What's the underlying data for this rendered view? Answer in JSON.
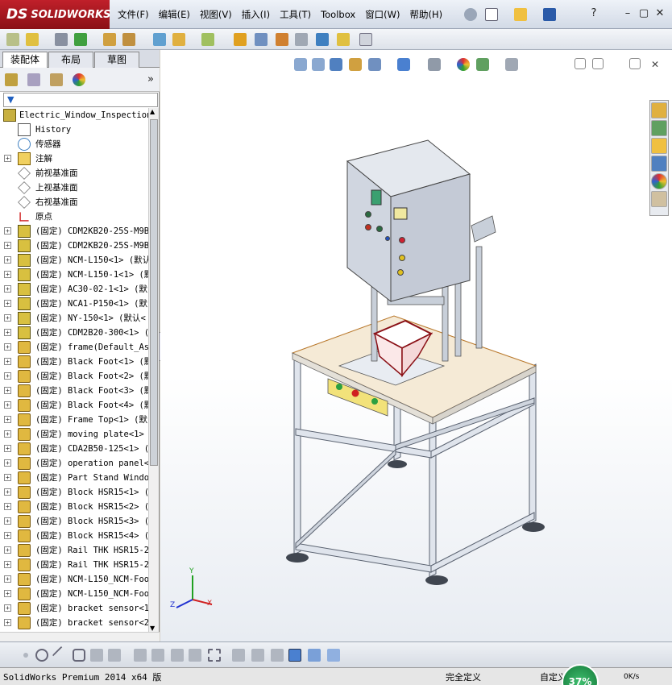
{
  "app": {
    "logo": "SOLIDWORKS",
    "ds": "DS"
  },
  "menu": [
    "文件(F)",
    "编辑(E)",
    "视图(V)",
    "插入(I)",
    "工具(T)",
    "Toolbox",
    "窗口(W)",
    "帮助(H)"
  ],
  "tabs": [
    "装配体",
    "布局",
    "草图"
  ],
  "tree": [
    {
      "label": "Electric_Window_Inspection",
      "icon": "assembly",
      "exp": false,
      "indent": 0
    },
    {
      "label": "History",
      "icon": "history",
      "exp": false,
      "indent": 1
    },
    {
      "label": "传感器",
      "icon": "sensor",
      "exp": false,
      "indent": 1
    },
    {
      "label": "注解",
      "icon": "annotation",
      "exp": true,
      "indent": 1
    },
    {
      "label": "前视基准面",
      "icon": "plane",
      "exp": false,
      "indent": 1
    },
    {
      "label": "上视基准面",
      "icon": "plane",
      "exp": false,
      "indent": 1
    },
    {
      "label": "右视基准面",
      "icon": "plane",
      "exp": false,
      "indent": 1
    },
    {
      "label": "原点",
      "icon": "origin",
      "exp": false,
      "indent": 1
    },
    {
      "label": "(固定) CDM2KB20-25S-M9B",
      "icon": "subasm",
      "exp": true,
      "indent": 1
    },
    {
      "label": "(固定) CDM2KB20-25S-M9B",
      "icon": "subasm",
      "exp": true,
      "indent": 1
    },
    {
      "label": "(固定) NCM-L150<1> (默认",
      "icon": "subasm",
      "exp": true,
      "indent": 1
    },
    {
      "label": "(固定) NCM-L150-1<1> (默",
      "icon": "subasm",
      "exp": true,
      "indent": 1
    },
    {
      "label": "(固定) AC30-02-1<1> (默",
      "icon": "subasm",
      "exp": true,
      "indent": 1
    },
    {
      "label": "(固定) NCA1-P150<1> (默",
      "icon": "subasm",
      "exp": true,
      "indent": 1
    },
    {
      "label": "(固定) NY-150<1> (默认<",
      "icon": "subasm",
      "exp": true,
      "indent": 1
    },
    {
      "label": "(固定) CDM2B20-300<1> (",
      "icon": "subasm",
      "exp": true,
      "indent": 1
    },
    {
      "label": "(固定) frame(Default_As",
      "icon": "part",
      "exp": true,
      "indent": 1
    },
    {
      "label": "(固定) Black Foot<1> (默",
      "icon": "part",
      "exp": true,
      "indent": 1
    },
    {
      "label": "(固定) Black Foot<2> (默",
      "icon": "part",
      "exp": true,
      "indent": 1
    },
    {
      "label": "(固定) Black Foot<3> (默",
      "icon": "part",
      "exp": true,
      "indent": 1
    },
    {
      "label": "(固定) Black Foot<4> (默",
      "icon": "part",
      "exp": true,
      "indent": 1
    },
    {
      "label": "(固定) Frame Top<1> (默",
      "icon": "part",
      "exp": true,
      "indent": 1
    },
    {
      "label": "(固定) moving plate<1>",
      "icon": "part",
      "exp": true,
      "indent": 1
    },
    {
      "label": "(固定) CDA2B50-125<1> (",
      "icon": "part",
      "exp": true,
      "indent": 1
    },
    {
      "label": "(固定) operation panel<",
      "icon": "part",
      "exp": true,
      "indent": 1
    },
    {
      "label": "(固定) Part Stand Windo",
      "icon": "part",
      "exp": true,
      "indent": 1
    },
    {
      "label": "(固定) Block HSR15<1> (",
      "icon": "part",
      "exp": true,
      "indent": 1
    },
    {
      "label": "(固定) Block HSR15<2> (",
      "icon": "part",
      "exp": true,
      "indent": 1
    },
    {
      "label": "(固定) Block HSR15<3> (",
      "icon": "part",
      "exp": true,
      "indent": 1
    },
    {
      "label": "(固定) Block HSR15<4> (",
      "icon": "part",
      "exp": true,
      "indent": 1
    },
    {
      "label": "(固定) Rail THK HSR15-2",
      "icon": "part",
      "exp": true,
      "indent": 1
    },
    {
      "label": "(固定) Rail THK HSR15-2",
      "icon": "part",
      "exp": true,
      "indent": 1
    },
    {
      "label": "(固定) NCM-L150_NCM-Foo",
      "icon": "part",
      "exp": true,
      "indent": 1
    },
    {
      "label": "(固定) NCM-L150_NCM-Foo",
      "icon": "part",
      "exp": true,
      "indent": 1
    },
    {
      "label": "(固定) bracket sensor<1",
      "icon": "part",
      "exp": true,
      "indent": 1
    },
    {
      "label": "(固定) bracket sensor<2",
      "icon": "part",
      "exp": true,
      "indent": 1
    }
  ],
  "triad": {
    "x": "X",
    "y": "Y",
    "z": "Z"
  },
  "status": {
    "left": "SolidWorks Premium 2014 x64 版",
    "mid": "完全定义",
    "edit": "自定义",
    "gauge": "37%",
    "speed": "0K/s"
  },
  "colors": {
    "accent": "#c0202a",
    "ground": "#ffffff",
    "panel_top": "#f5ead6",
    "box": "#d0d6e0"
  }
}
